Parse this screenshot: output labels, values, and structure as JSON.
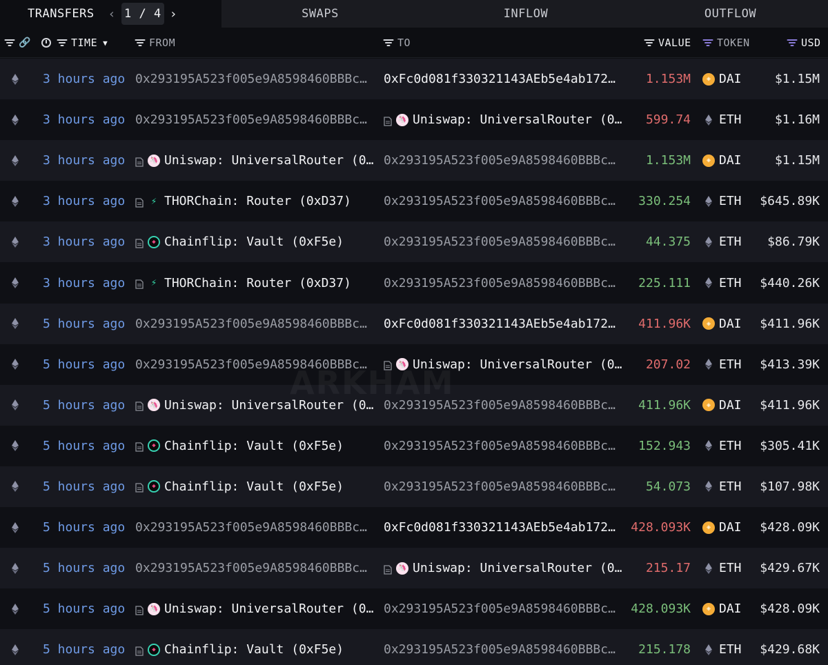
{
  "tabs": {
    "transfers": "TRANSFERS",
    "swaps": "SWAPS",
    "inflow": "INFLOW",
    "outflow": "OUTFLOW",
    "page_current": "1",
    "page_sep": "/",
    "page_total": "4"
  },
  "columns": {
    "time": "TIME",
    "from": "FROM",
    "to": "TO",
    "value": "VALUE",
    "token": "TOKEN",
    "usd": "USD"
  },
  "watermark": "ARKHAM",
  "colors": {
    "time_link": "#6f9be6",
    "value_out": "#e06c6c",
    "value_in": "#7bbf7a",
    "dai": "#f5ac37"
  },
  "rows": [
    {
      "time": "3 hours ago",
      "from": {
        "kind": "addr",
        "text": "0x293195A523f005e9A8598460BBBc9…"
      },
      "to": {
        "kind": "addr_bright",
        "text": "0xFc0d081f330321143AEb5e4ab1729…"
      },
      "value": "1.153M",
      "dir": "out",
      "token": "DAI",
      "usd": "$1.15M"
    },
    {
      "time": "3 hours ago",
      "from": {
        "kind": "addr",
        "text": "0x293195A523f005e9A8598460BBBc9…"
      },
      "to": {
        "kind": "entity",
        "logo": "uniswap",
        "text": "Uniswap: UniversalRouter (0…"
      },
      "value": "599.74",
      "dir": "out",
      "token": "ETH",
      "usd": "$1.16M"
    },
    {
      "time": "3 hours ago",
      "from": {
        "kind": "entity",
        "logo": "uniswap",
        "text": "Uniswap: UniversalRouter (0…"
      },
      "to": {
        "kind": "addr",
        "text": "0x293195A523f005e9A8598460BBBc9…"
      },
      "value": "1.153M",
      "dir": "in",
      "token": "DAI",
      "usd": "$1.15M"
    },
    {
      "time": "3 hours ago",
      "from": {
        "kind": "entity",
        "logo": "thorchain",
        "text": "THORChain: Router (0xD37)"
      },
      "to": {
        "kind": "addr",
        "text": "0x293195A523f005e9A8598460BBBc9…"
      },
      "value": "330.254",
      "dir": "in",
      "token": "ETH",
      "usd": "$645.89K"
    },
    {
      "time": "3 hours ago",
      "from": {
        "kind": "entity",
        "logo": "chainflip",
        "text": "Chainflip: Vault (0xF5e)"
      },
      "to": {
        "kind": "addr",
        "text": "0x293195A523f005e9A8598460BBBc9…"
      },
      "value": "44.375",
      "dir": "in",
      "token": "ETH",
      "usd": "$86.79K"
    },
    {
      "time": "3 hours ago",
      "from": {
        "kind": "entity",
        "logo": "thorchain",
        "text": "THORChain: Router (0xD37)"
      },
      "to": {
        "kind": "addr",
        "text": "0x293195A523f005e9A8598460BBBc9…"
      },
      "value": "225.111",
      "dir": "in",
      "token": "ETH",
      "usd": "$440.26K"
    },
    {
      "time": "5 hours ago",
      "from": {
        "kind": "addr",
        "text": "0x293195A523f005e9A8598460BBBc9…"
      },
      "to": {
        "kind": "addr_bright",
        "text": "0xFc0d081f330321143AEb5e4ab1729…"
      },
      "value": "411.96K",
      "dir": "out",
      "token": "DAI",
      "usd": "$411.96K"
    },
    {
      "time": "5 hours ago",
      "from": {
        "kind": "addr",
        "text": "0x293195A523f005e9A8598460BBBc9…"
      },
      "to": {
        "kind": "entity",
        "logo": "uniswap",
        "text": "Uniswap: UniversalRouter (0…"
      },
      "value": "207.02",
      "dir": "out",
      "token": "ETH",
      "usd": "$413.39K"
    },
    {
      "time": "5 hours ago",
      "from": {
        "kind": "entity",
        "logo": "uniswap",
        "text": "Uniswap: UniversalRouter (0…"
      },
      "to": {
        "kind": "addr",
        "text": "0x293195A523f005e9A8598460BBBc9…"
      },
      "value": "411.96K",
      "dir": "in",
      "token": "DAI",
      "usd": "$411.96K"
    },
    {
      "time": "5 hours ago",
      "from": {
        "kind": "entity",
        "logo": "chainflip",
        "text": "Chainflip: Vault (0xF5e)"
      },
      "to": {
        "kind": "addr",
        "text": "0x293195A523f005e9A8598460BBBc9…"
      },
      "value": "152.943",
      "dir": "in",
      "token": "ETH",
      "usd": "$305.41K"
    },
    {
      "time": "5 hours ago",
      "from": {
        "kind": "entity",
        "logo": "chainflip",
        "text": "Chainflip: Vault (0xF5e)"
      },
      "to": {
        "kind": "addr",
        "text": "0x293195A523f005e9A8598460BBBc9…"
      },
      "value": "54.073",
      "dir": "in",
      "token": "ETH",
      "usd": "$107.98K"
    },
    {
      "time": "5 hours ago",
      "from": {
        "kind": "addr",
        "text": "0x293195A523f005e9A8598460BBBc9…"
      },
      "to": {
        "kind": "addr_bright",
        "text": "0xFc0d081f330321143AEb5e4ab1729…"
      },
      "value": "428.093K",
      "dir": "out",
      "token": "DAI",
      "usd": "$428.09K"
    },
    {
      "time": "5 hours ago",
      "from": {
        "kind": "addr",
        "text": "0x293195A523f005e9A8598460BBBc9…"
      },
      "to": {
        "kind": "entity",
        "logo": "uniswap",
        "text": "Uniswap: UniversalRouter (0…"
      },
      "value": "215.17",
      "dir": "out",
      "token": "ETH",
      "usd": "$429.67K"
    },
    {
      "time": "5 hours ago",
      "from": {
        "kind": "entity",
        "logo": "uniswap",
        "text": "Uniswap: UniversalRouter (0…"
      },
      "to": {
        "kind": "addr",
        "text": "0x293195A523f005e9A8598460BBBc9…"
      },
      "value": "428.093K",
      "dir": "in",
      "token": "DAI",
      "usd": "$428.09K"
    },
    {
      "time": "5 hours ago",
      "from": {
        "kind": "entity",
        "logo": "chainflip",
        "text": "Chainflip: Vault (0xF5e)"
      },
      "to": {
        "kind": "addr",
        "text": "0x293195A523f005e9A8598460BBBc9…"
      },
      "value": "215.178",
      "dir": "in",
      "token": "ETH",
      "usd": "$429.68K"
    }
  ]
}
